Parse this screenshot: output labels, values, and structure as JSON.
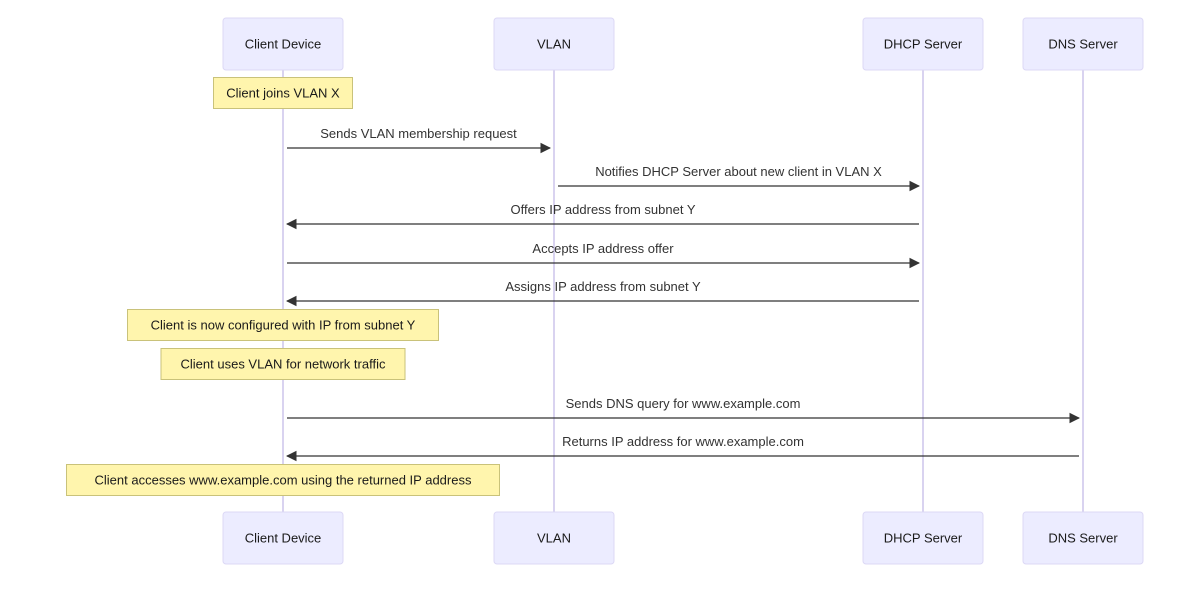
{
  "diagram": {
    "type": "sequence",
    "colors": {
      "actor_fill": "#ECECFF",
      "actor_border": "#dcd8f5",
      "lifeline": "#d9d3f0",
      "note_fill": "#fff5ad",
      "note_border": "#c9c27a",
      "message": "#333333"
    },
    "actors": [
      {
        "id": "client",
        "label": "Client Device"
      },
      {
        "id": "vlan",
        "label": "VLAN"
      },
      {
        "id": "dhcp",
        "label": "DHCP Server"
      },
      {
        "id": "dns",
        "label": "DNS Server"
      }
    ],
    "steps": [
      {
        "kind": "note",
        "over": "client",
        "text": "Client joins VLAN X"
      },
      {
        "kind": "message",
        "from": "client",
        "to": "vlan",
        "text": "Sends VLAN membership request"
      },
      {
        "kind": "message",
        "from": "vlan",
        "to": "dhcp",
        "text": "Notifies DHCP Server about new client in VLAN X"
      },
      {
        "kind": "message",
        "from": "dhcp",
        "to": "client",
        "text": "Offers IP address from subnet Y"
      },
      {
        "kind": "message",
        "from": "client",
        "to": "dhcp",
        "text": "Accepts IP address offer"
      },
      {
        "kind": "message",
        "from": "dhcp",
        "to": "client",
        "text": "Assigns IP address from subnet Y"
      },
      {
        "kind": "note",
        "over": "client",
        "text": "Client is now configured with IP from subnet Y"
      },
      {
        "kind": "note",
        "over": "client",
        "text": "Client uses VLAN for network traffic"
      },
      {
        "kind": "message",
        "from": "client",
        "to": "dns",
        "text": "Sends DNS query for www.example.com"
      },
      {
        "kind": "message",
        "from": "dns",
        "to": "client",
        "text": "Returns IP address for www.example.com"
      },
      {
        "kind": "note",
        "over": "client",
        "text": "Client accesses www.example.com using the returned IP address"
      }
    ]
  }
}
